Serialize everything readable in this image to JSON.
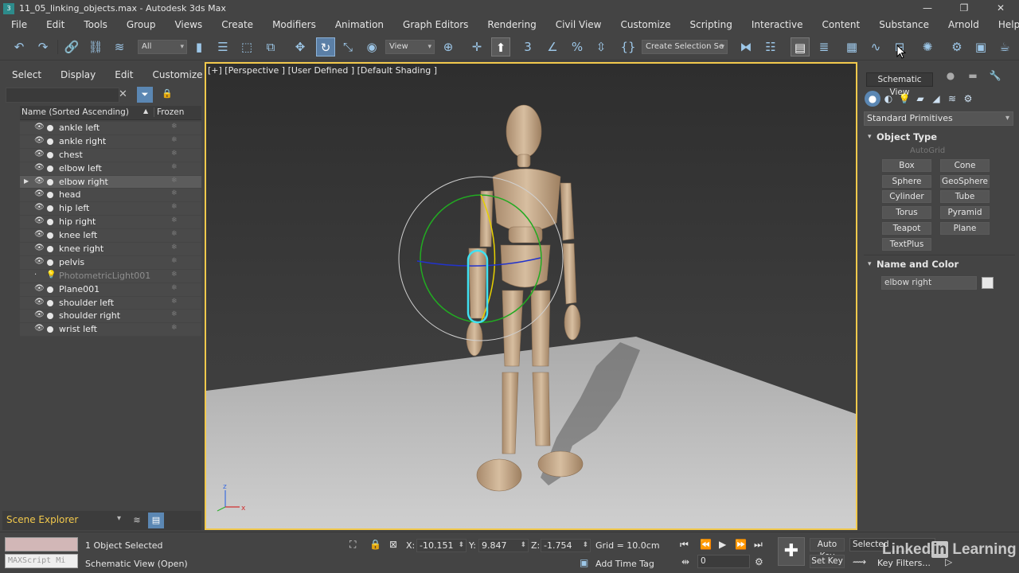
{
  "window": {
    "title": "11_05_linking_objects.max - Autodesk 3ds Max",
    "app_icon": "3ds-max-icon"
  },
  "menu": [
    "File",
    "Edit",
    "Tools",
    "Group",
    "Views",
    "Create",
    "Modifiers",
    "Animation",
    "Graph Editors",
    "Rendering",
    "Civil View",
    "Customize",
    "Scripting",
    "Interactive",
    "Content",
    "Substance",
    "Arnold",
    "Help"
  ],
  "toolbar": {
    "filter_dropdown": "All",
    "ref_coord_dropdown": "View",
    "named_selection": "Create Selection Se"
  },
  "explorer": {
    "menu": [
      "Select",
      "Display",
      "Edit",
      "Customize"
    ],
    "search_placeholder": "",
    "col_name": "Name (Sorted Ascending)",
    "col_frozen": "Frozen",
    "rows": [
      {
        "name": "ankle left",
        "type": "object"
      },
      {
        "name": "ankle right",
        "type": "object"
      },
      {
        "name": "chest",
        "type": "object"
      },
      {
        "name": "elbow left",
        "type": "object"
      },
      {
        "name": "elbow right",
        "type": "object",
        "selected": true,
        "expandable": true
      },
      {
        "name": "head",
        "type": "object"
      },
      {
        "name": "hip left",
        "type": "object"
      },
      {
        "name": "hip right",
        "type": "object"
      },
      {
        "name": "knee left",
        "type": "object"
      },
      {
        "name": "knee right",
        "type": "object"
      },
      {
        "name": "pelvis",
        "type": "object"
      },
      {
        "name": "PhotometricLight001",
        "type": "light",
        "hidden": true
      },
      {
        "name": "Plane001",
        "type": "object"
      },
      {
        "name": "shoulder left",
        "type": "object"
      },
      {
        "name": "shoulder right",
        "type": "object"
      },
      {
        "name": "wrist left",
        "type": "object"
      }
    ],
    "footer_label": "Scene Explorer"
  },
  "viewport": {
    "label": "[+] [Perspective ] [User Defined ] [Default Shading ]",
    "axis_x": "x",
    "axis_z": "z",
    "colors": {
      "highlight": "#40e0f0",
      "border": "#f2c94c",
      "ground": "#b7b7b7"
    }
  },
  "tooltip": "Schematic View",
  "command_panel": {
    "category": "Standard Primitives",
    "object_type_title": "Object Type",
    "autogrid": "AutoGrid",
    "buttons": [
      "Box",
      "Cone",
      "Sphere",
      "GeoSphere",
      "Cylinder",
      "Tube",
      "Torus",
      "Pyramid",
      "Teapot",
      "Plane",
      "TextPlus"
    ],
    "name_color_title": "Name and Color",
    "object_name": "elbow right",
    "swatch_color": "#e8e8e8"
  },
  "status": {
    "selection_count": "1 Object Selected",
    "prompt": "Schematic View (Open)",
    "maxscript_placeholder": "MAXScript Mi",
    "x_label": "X:",
    "x": "-10.151",
    "y_label": "Y:",
    "y": "9.847",
    "z_label": "Z:",
    "z": "-1.754",
    "grid": "Grid = 10.0cm",
    "add_time_tag": "Add Time Tag",
    "auto_key": "Auto Key",
    "set_key": "Set Key",
    "selected_dropdown": "Selected",
    "key_filters": "Key Filters...",
    "frame": "0"
  },
  "watermark": {
    "text": "Linked",
    "in": "in",
    "suffix": "Learning"
  }
}
